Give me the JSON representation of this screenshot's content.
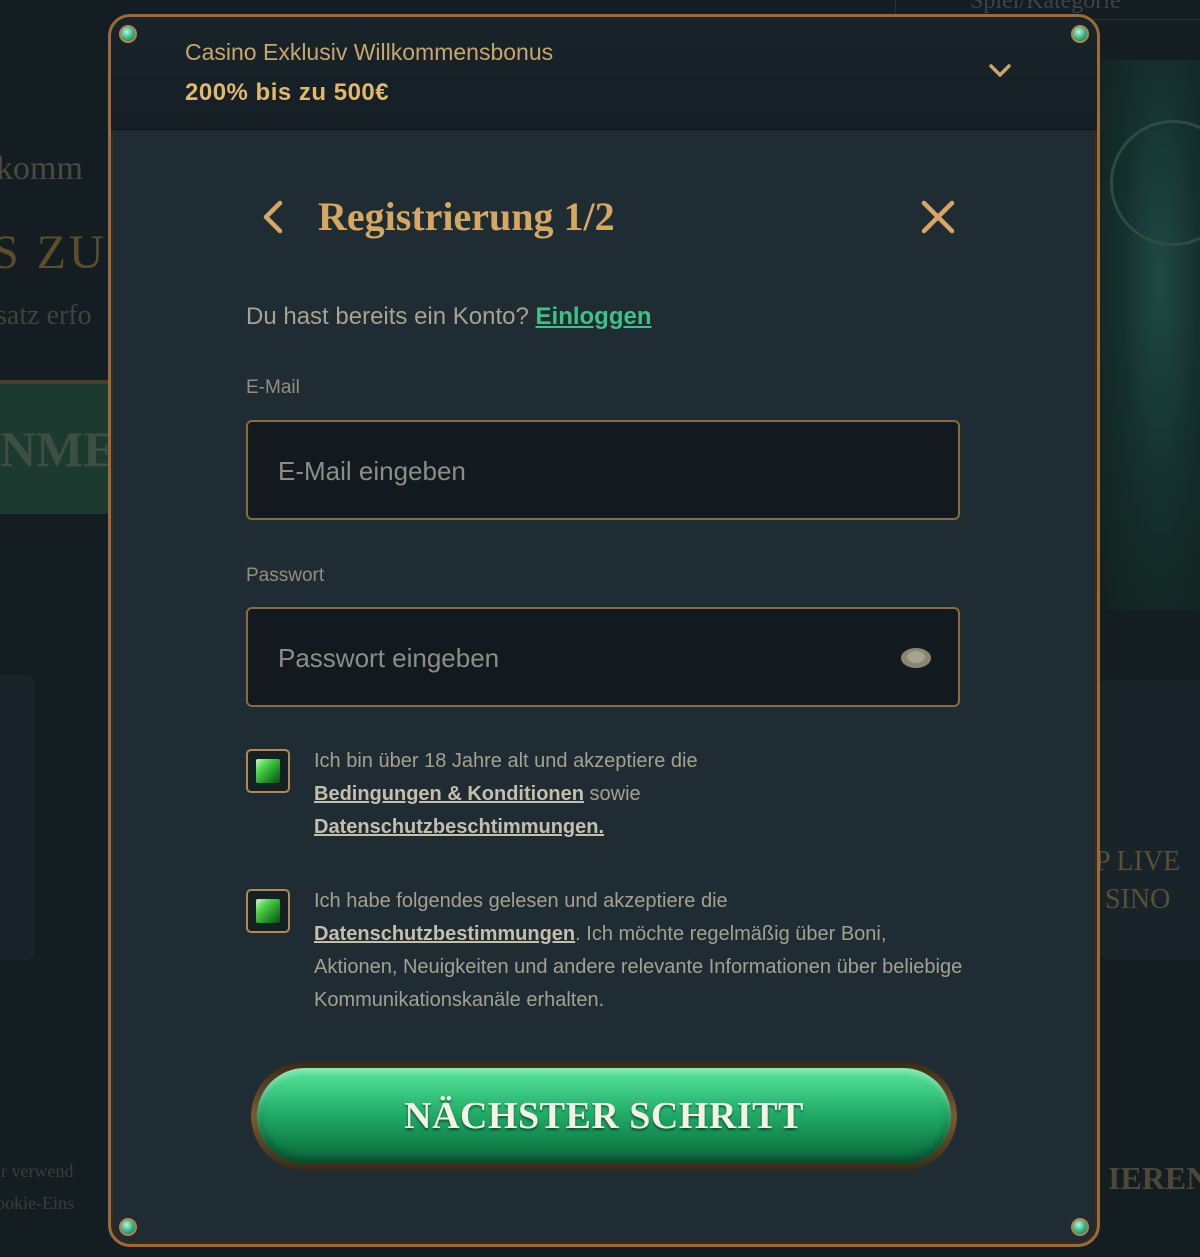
{
  "background": {
    "search_placeholder": "Spiel/Kategorie",
    "welcome_fragment": "komm",
    "bonus_fragment": "S ZU",
    "wager_fragment": "satz erfo",
    "button_fragment": "NME",
    "live_casino_fragment_1": "P LIVE",
    "live_casino_fragment_2": "SINO",
    "register_fragment": "IEREN",
    "cookie_fragment_1": "ir verwend",
    "cookie_fragment_2": "ookie-Eins"
  },
  "bonus_bar": {
    "title": "Casino Exklusiv Willkommensbonus",
    "amount": "200% bis zu 500€",
    "toggle_icon": "chevron-down-icon"
  },
  "header": {
    "title": "Registrierung 1/2",
    "back_icon": "chevron-left-icon",
    "close_icon": "close-icon"
  },
  "login_prompt": {
    "text": "Du hast bereits ein Konto?",
    "link": "Einloggen"
  },
  "email": {
    "label": "E-Mail",
    "placeholder": "E-Mail eingeben"
  },
  "password": {
    "label": "Passwort",
    "placeholder": "Passwort eingeben",
    "toggle_icon": "eye-icon"
  },
  "terms_checkbox": {
    "checked": true,
    "text_1": "Ich bin über 18 Jahre alt und akzeptiere die",
    "link_1": "Bedingungen & Konditionen",
    "text_2": "sowie",
    "link_2": "Datenschutzbeschtimmungen."
  },
  "marketing_checkbox": {
    "checked": true,
    "text_1": "Ich habe folgendes gelesen und akzeptiere die",
    "link_1": "Datenschutzbestimmungen",
    "text_2": ". Ich möchte regelmäßig über Boni, Aktionen, Neuigkeiten und andere relevante Informationen über beliebige Kommunikationskanäle erhalten."
  },
  "submit": {
    "label": "NÄCHSTER SCHRITT"
  },
  "colors": {
    "accent_gold": "#d6a762",
    "accent_green": "#3cc286",
    "modal_bg": "#1f2c34"
  }
}
